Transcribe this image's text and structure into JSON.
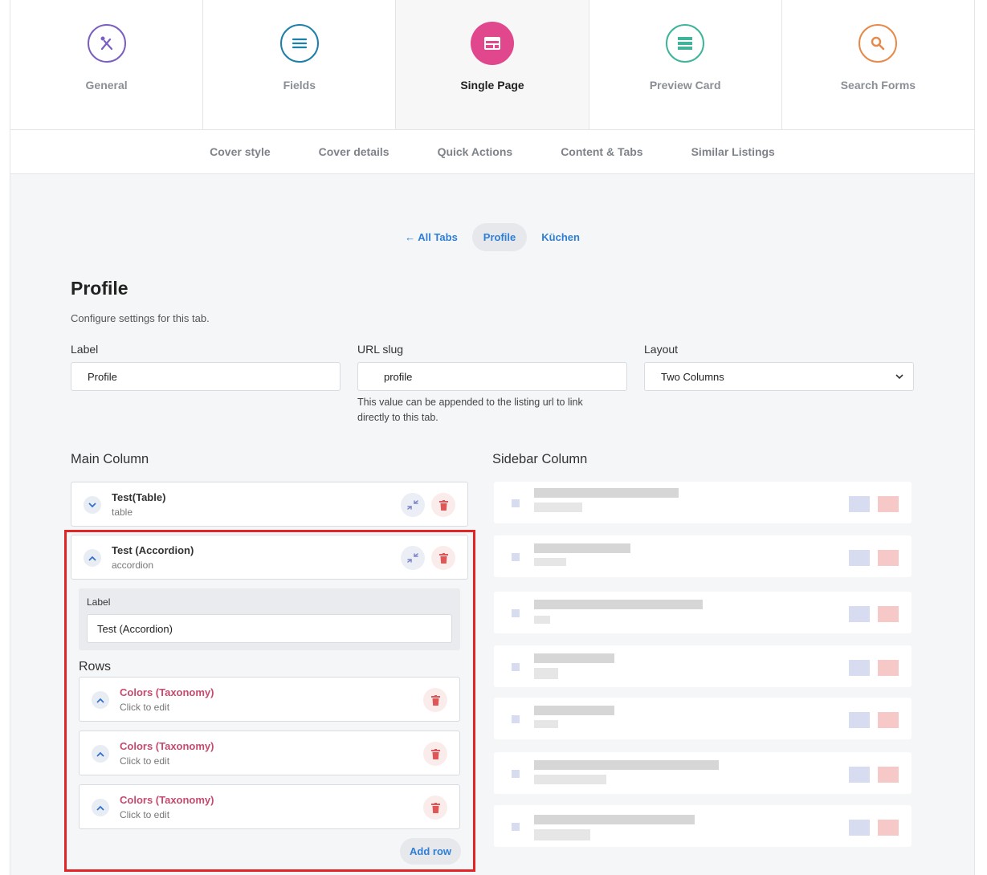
{
  "steps": [
    {
      "label": "General",
      "icon": "utensils-icon",
      "color": "#7b5fc0",
      "active": false
    },
    {
      "label": "Fields",
      "icon": "list-icon",
      "color": "#1e7fa8",
      "active": false
    },
    {
      "label": "Single Page",
      "icon": "layout-icon",
      "color": "#e0478c",
      "active": true
    },
    {
      "label": "Preview Card",
      "icon": "card-icon",
      "color": "#3fb49a",
      "active": false
    },
    {
      "label": "Search Forms",
      "icon": "search-icon",
      "color": "#e68a4c",
      "active": false
    }
  ],
  "subnav": [
    "Cover style",
    "Cover details",
    "Quick Actions",
    "Content & Tabs",
    "Similar Listings"
  ],
  "crumbs": {
    "back": "← All Tabs",
    "current": "Profile",
    "next": "Küchen"
  },
  "page": {
    "title": "Profile",
    "subtitle": "Configure settings for this tab."
  },
  "form": {
    "label": {
      "title": "Label",
      "value": "Profile"
    },
    "slug": {
      "title": "URL slug",
      "value": "profile",
      "help": "This value can be appended to the listing url to link directly to this tab."
    },
    "layout": {
      "title": "Layout",
      "value": "Two Columns"
    }
  },
  "main_column": {
    "heading": "Main Column",
    "blocks": [
      {
        "title": "Test(Table)",
        "type": "table"
      },
      {
        "title": "Test (Accordion)",
        "type": "accordion"
      }
    ],
    "accordion": {
      "label_title": "Label",
      "label_value": "Test (Accordion)",
      "rows_heading": "Rows",
      "rows": [
        {
          "title": "Colors (Taxonomy)",
          "sub": "Click to edit"
        },
        {
          "title": "Colors (Taxonomy)",
          "sub": "Click to edit"
        },
        {
          "title": "Colors (Taxonomy)",
          "sub": "Click to edit"
        }
      ],
      "add_row": "Add row"
    }
  },
  "sidebar_column": {
    "heading": "Sidebar Column"
  },
  "colors": {
    "accent": "#2f7fd6",
    "highlight": "#e32424",
    "row_title": "#c64a6e",
    "delete": "#e05555",
    "move": "#7e87c8"
  }
}
